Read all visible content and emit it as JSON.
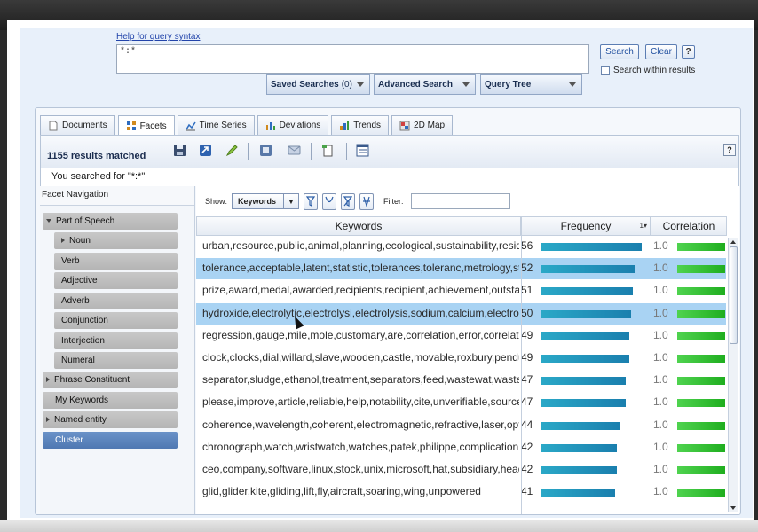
{
  "search": {
    "help_link": "Help for query syntax",
    "query": "*:*",
    "search_label": "Search",
    "clear_label": "Clear",
    "help_label": "?",
    "within_label": "Search within results"
  },
  "dropdowns": {
    "saved_label": "Saved Searches",
    "saved_count": "(0)",
    "advanced_label": "Advanced Search",
    "tree_label": "Query Tree"
  },
  "tabs": [
    {
      "label": "Documents"
    },
    {
      "label": "Facets"
    },
    {
      "label": "Time Series"
    },
    {
      "label": "Deviations"
    },
    {
      "label": "Trends"
    },
    {
      "label": "2D Map"
    }
  ],
  "toolbar": {
    "results": "1155 results matched",
    "help": "?"
  },
  "searched_for": "You searched for \"*:*\"",
  "facet_nav": {
    "title": "Facet Navigation",
    "items": [
      {
        "label": "Part of Speech"
      },
      {
        "label": "Noun"
      },
      {
        "label": "Verb"
      },
      {
        "label": "Adjective"
      },
      {
        "label": "Adverb"
      },
      {
        "label": "Conjunction"
      },
      {
        "label": "Interjection"
      },
      {
        "label": "Numeral"
      },
      {
        "label": "Phrase Constituent"
      },
      {
        "label": "My Keywords"
      },
      {
        "label": "Named entity"
      },
      {
        "label": "Cluster"
      }
    ]
  },
  "table": {
    "show_label": "Show:",
    "show_value": "Keywords",
    "filter_label": "Filter:",
    "col_keywords": "Keywords",
    "col_frequency": "Frequency",
    "sort_indicator": "1▾",
    "col_correlation": "Correlation",
    "rows": [
      {
        "keywords": "urban,resource,public,animal,planning,ecological,sustainability,residents",
        "freq": 56,
        "corr": "1.0"
      },
      {
        "keywords": "tolerance,acceptable,latent,statistic,tolerances,toleranc,metrology,statis",
        "freq": 52,
        "corr": "1.0"
      },
      {
        "keywords": "prize,award,medal,awarded,recipients,recipient,achievement,outstanding",
        "freq": 51,
        "corr": "1.0"
      },
      {
        "keywords": "hydroxide,electrolytic,electrolysi,electrolysis,sodium,calcium,electrolyte,r",
        "freq": 50,
        "corr": "1.0"
      },
      {
        "keywords": "regression,gauge,mile,mole,customary,are,correlation,error,correlat,var",
        "freq": 49,
        "corr": "1.0"
      },
      {
        "keywords": "clock,clocks,dial,willard,slave,wooden,castle,movable,roxbury,pendulum",
        "freq": 49,
        "corr": "1.0"
      },
      {
        "keywords": "separator,sludge,ethanol,treatment,separators,feed,wastewat,wastewa",
        "freq": 47,
        "corr": "1.0"
      },
      {
        "keywords": "please,improve,article,reliable,help,notability,cite,unverifiable,sources,so",
        "freq": 47,
        "corr": "1.0"
      },
      {
        "keywords": "coherence,wavelength,coherent,electromagnetic,refractive,laser,optical,l",
        "freq": 44,
        "corr": "1.0"
      },
      {
        "keywords": "chronograph,watch,wristwatch,watches,patek,philippe,complication,mai",
        "freq": 42,
        "corr": "1.0"
      },
      {
        "keywords": "ceo,company,software,linux,stock,unix,microsoft,hat,subsidiary,headqu",
        "freq": 42,
        "corr": "1.0"
      },
      {
        "keywords": "glid,glider,kite,gliding,lift,fly,aircraft,soaring,wing,unpowered",
        "freq": 41,
        "corr": "1.0"
      }
    ]
  }
}
